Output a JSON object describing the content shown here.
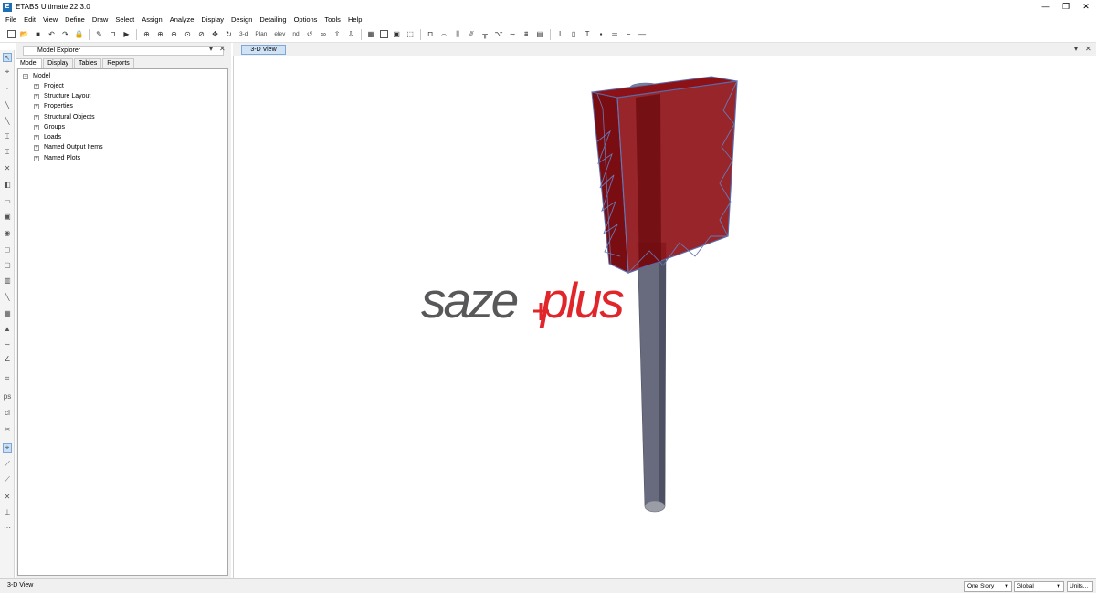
{
  "window": {
    "title": "ETABS Ultimate 22.3.0",
    "app_icon_letter": "E",
    "minimize": "—",
    "maximize": "❐",
    "close": "✕"
  },
  "menu": [
    "File",
    "Edit",
    "View",
    "Define",
    "Draw",
    "Select",
    "Assign",
    "Analyze",
    "Display",
    "Design",
    "Detailing",
    "Options",
    "Tools",
    "Help"
  ],
  "toolbar": {
    "view_3d_label": "3-d",
    "plan_label": "Plan",
    "elev_label": "elev",
    "nd_label": "nd"
  },
  "explorer": {
    "title": "Model Explorer",
    "pin": "▾",
    "close": "✕",
    "tabs": [
      "Model",
      "Display",
      "Tables",
      "Reports"
    ],
    "selected_tab": "Model",
    "root": "Model",
    "items": [
      "Project",
      "Structure Layout",
      "Properties",
      "Structural Objects",
      "Groups",
      "Loads",
      "Named Output Items",
      "Named Plots"
    ]
  },
  "view": {
    "tab_label": "3-D View",
    "pin": "▾",
    "close": "✕",
    "watermark_part1": "saze",
    "watermark_part2": "plus",
    "colors": {
      "panel_face": "#8a0f14",
      "panel_frame": "#5a6aa8",
      "pole": "#6b6e80",
      "watermark_dark": "#58585a",
      "watermark_red": "#e0262b"
    }
  },
  "status": {
    "left_text": "3-D View",
    "story_option": "One Story",
    "coord_option": "Global",
    "units_label": "Units..."
  }
}
